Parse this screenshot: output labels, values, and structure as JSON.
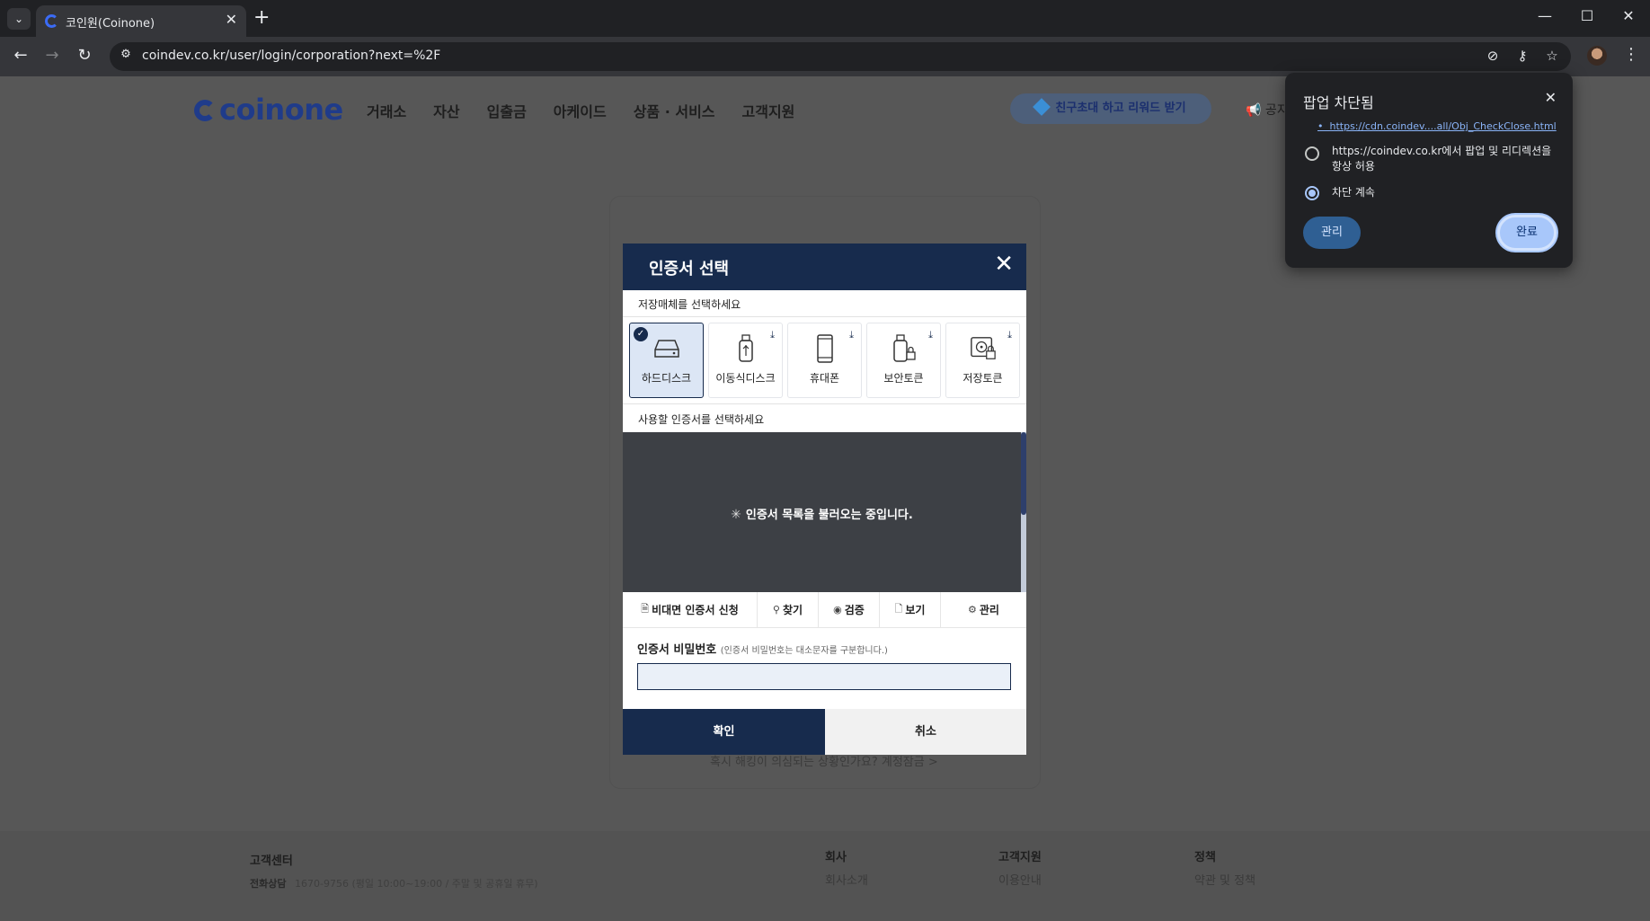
{
  "browser": {
    "tab_title": "코인원(Coinone)",
    "url": "coindev.co.kr/user/login/corporation?next=%2F"
  },
  "site": {
    "logo": "coinone",
    "nav": [
      "거래소",
      "자산",
      "입출금",
      "아케이드",
      "상품 · 서비스",
      "고객지원"
    ],
    "promo": "친구초대 하고 리워드 받기",
    "notice": "공지"
  },
  "login": {
    "hack_link": "혹시 해킹이 의심되는 상황인가요? 계정잠금 >"
  },
  "footer": {
    "support_center": "고객센터",
    "phone_label": "전화상담",
    "phone_detail": "1670-9756 (평일 10:00~19:00 / 주말 및 공휴일 휴무)",
    "col1_head": "회사",
    "col1_item": "회사소개",
    "col2_head": "고객지원",
    "col2_item": "이용안내",
    "col3_head": "정책",
    "col3_item": "약관 및 정책"
  },
  "cert_dialog": {
    "title": "인증서 선택",
    "media_label": "저장매체를 선택하세요",
    "media": [
      {
        "label": "하드디스크",
        "icon": "hard-disk-icon",
        "selected": true
      },
      {
        "label": "이동식디스크",
        "icon": "usb-icon",
        "selected": false
      },
      {
        "label": "휴대폰",
        "icon": "phone-icon",
        "selected": false
      },
      {
        "label": "보안토큰",
        "icon": "security-token-icon",
        "selected": false
      },
      {
        "label": "저장토큰",
        "icon": "storage-token-icon",
        "selected": false
      }
    ],
    "cert_label": "사용할 인증서를 선택하세요",
    "loading_text": "인증서 목록을 불러오는 중입니다.",
    "actions": [
      "비대면 인증서 신청",
      "찾기",
      "검증",
      "보기",
      "관리"
    ],
    "password_label": "인증서 비밀번호",
    "password_hint": "(인증서 비밀번호는 대소문자를 구분합니다.)",
    "password_value": "",
    "ok": "확인",
    "cancel": "취소"
  },
  "popup_blocked": {
    "title": "팝업 차단됨",
    "blocked_url": "https://cdn.coindev....all/Obj_CheckClose.html",
    "option_allow": "https://coindev.co.kr에서 팝업 및 리디렉션을 항상 허용",
    "option_block": "차단 계속",
    "selected_option": "차단 계속",
    "manage": "관리",
    "done": "완료"
  },
  "colors": {
    "brand_navy": "#172b4d",
    "chrome_dark": "#202124",
    "chrome_accent": "#a8c7fa"
  }
}
